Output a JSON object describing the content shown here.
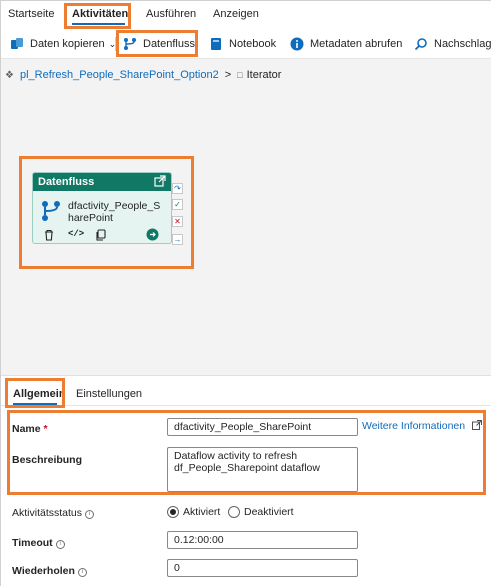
{
  "nav": {
    "tabs": [
      {
        "label": "Startseite"
      },
      {
        "label": "Aktivitäten"
      },
      {
        "label": "Ausführen"
      },
      {
        "label": "Anzeigen"
      }
    ]
  },
  "toolbar": {
    "copy_data": "Daten kopieren",
    "dataflow": "Datenfluss",
    "notebook": "Notebook",
    "get_metadata": "Metadaten abrufen",
    "lookup": "Nachschlage"
  },
  "breadcrumb": {
    "pipeline": "pl_Refresh_People_SharePoint_Option2",
    "separator": ">",
    "current": "Iterator"
  },
  "activity": {
    "type": "Datenfluss",
    "name_line1": "dfactivity_People_S",
    "name_line2": "harePoint"
  },
  "panel": {
    "tabs": [
      {
        "label": "Allgemein"
      },
      {
        "label": "Einstellungen"
      }
    ],
    "name_label": "Name",
    "required_mark": "*",
    "name_value": "dfactivity_People_SharePoint",
    "more_info": "Weitere Informationen",
    "description_label": "Beschreibung",
    "description_value": "Dataflow activity to refresh\ndf_People_Sharepoint dataflow",
    "status_label": "Aktivitätsstatus",
    "status_options": [
      "Aktiviert",
      "Deaktiviert"
    ],
    "status_selected": "Aktiviert",
    "timeout_label": "Timeout",
    "timeout_value": "0.12:00:00",
    "retry_label": "Wiederholen",
    "retry_value": "0"
  },
  "colors": {
    "accent": "#0f6cbd",
    "highlight": "#ed7d31",
    "activity_header": "#117865"
  }
}
